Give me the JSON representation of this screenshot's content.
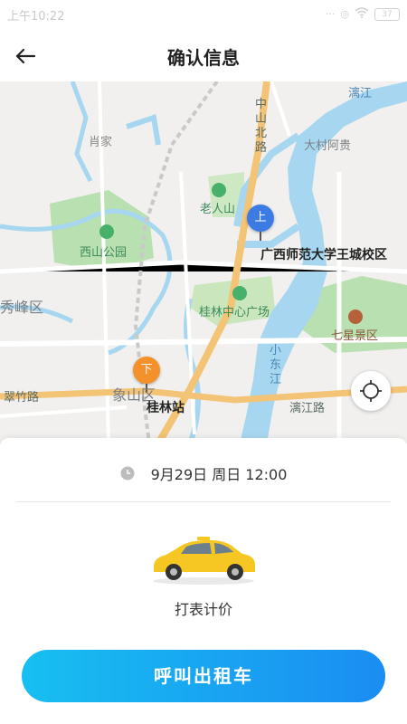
{
  "status_bar": {
    "time": "上午10:22",
    "battery": "37"
  },
  "header": {
    "title": "确认信息",
    "back_icon": "arrow-left-icon"
  },
  "map": {
    "labels": {
      "road_zhongshan": "中山北路",
      "lijiang_river": "漓江",
      "xiaojia": "肖家",
      "dacun": "大村阿贵",
      "laorenshan": "老人山",
      "xishan_park": "西山公园",
      "destination_start": "广西师范大学王城校区",
      "xiufeng": "秀峰区",
      "center_square": "桂林中心广场",
      "qixing": "七星景区",
      "xiaodongjiang": "小东江",
      "cuizhu_road": "翠竹路",
      "xiangshan": "象山区",
      "guilin_station": "桂林站",
      "lijiang_road": "漓江路"
    },
    "start_pin": "上",
    "end_pin": "下",
    "locate_icon": "crosshair-icon"
  },
  "sheet": {
    "time_text": "9月29日 周日 12:00",
    "car_type": "打表计价",
    "call_button": "呼叫出租车"
  }
}
